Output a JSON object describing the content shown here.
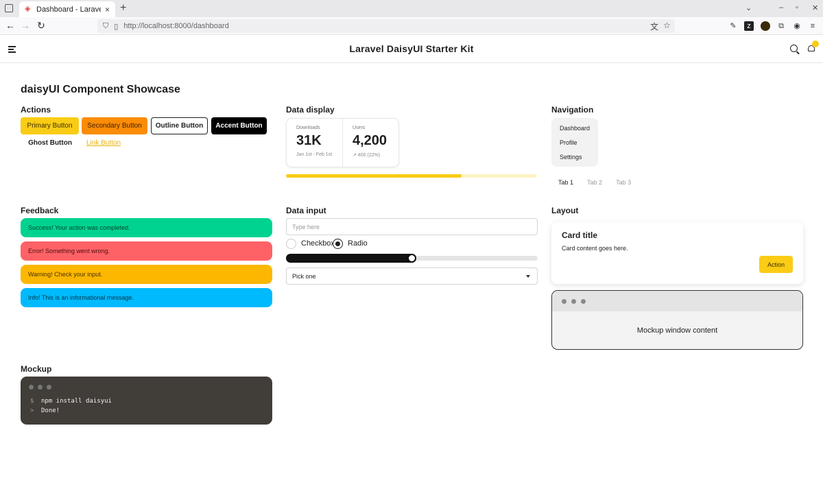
{
  "browser": {
    "tab_title": "Dashboard - Laravel",
    "tab_close": "×",
    "new_tab": "+",
    "url_host": "http://localhost",
    "url_path": ":8000/dashboard"
  },
  "app": {
    "title": "Laravel DaisyUI Starter Kit"
  },
  "page": {
    "title": "daisyUI Component Showcase"
  },
  "actions": {
    "heading": "Actions",
    "primary": "Primary Button",
    "secondary": "Secondary Button",
    "outline": "Outline Button",
    "accent": "Accent Button",
    "ghost": "Ghost Button",
    "link": "Link Button"
  },
  "data_display": {
    "heading": "Data display",
    "stats": [
      {
        "title": "Downloads",
        "value": "31K",
        "desc": "Jan 1st - Feb 1st"
      },
      {
        "title": "Users",
        "value": "4,200",
        "desc": "↗︎ 400 (22%)"
      }
    ],
    "progress": 0.7
  },
  "navigation": {
    "heading": "Navigation",
    "menu": [
      "Dashboard",
      "Profile",
      "Settings"
    ],
    "tabs": [
      "Tab 1",
      "Tab 2",
      "Tab 3"
    ],
    "active_tab": "Tab 1"
  },
  "feedback": {
    "heading": "Feedback",
    "success": "Success! Your action was completed.",
    "error": "Error! Something went wrong.",
    "warning": "Warning! Check your input.",
    "info": "Info! This is an informational message."
  },
  "data_input": {
    "heading": "Data input",
    "text_placeholder": "Type here",
    "checkbox_label": "Checkbox",
    "radio_label": "Radio",
    "range_value": 0.5,
    "select_value": "Pick one"
  },
  "layout": {
    "heading": "Layout",
    "card_title": "Card title",
    "card_body": "Card content goes here.",
    "card_action": "Action",
    "window_content": "Mockup window content"
  },
  "mockup": {
    "heading": "Mockup",
    "lines": [
      {
        "prefix": "$",
        "text": "npm install daisyui"
      },
      {
        "prefix": ">",
        "text": "Done!"
      }
    ]
  },
  "colors": {
    "primary": "#facc15",
    "secondary": "#fb8c07",
    "success": "#00d390",
    "error": "#ff6266",
    "warning": "#fcb700",
    "info": "#00bafe"
  }
}
